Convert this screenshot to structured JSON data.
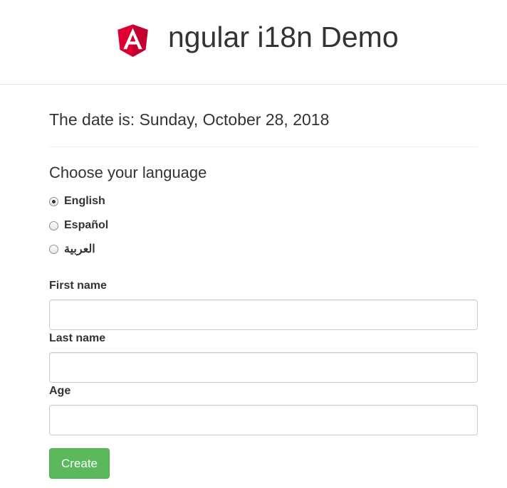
{
  "header": {
    "title": "ngular i18n Demo",
    "logo": {
      "icon": "angular-logo-icon",
      "letter": "A",
      "colors": [
        "#dd0031",
        "#c3002f",
        "#ffffff"
      ]
    }
  },
  "date_line": "The date is: Sunday, October 28, 2018",
  "language": {
    "heading": "Choose your language",
    "options": [
      {
        "label": "English",
        "checked": true
      },
      {
        "label": "Español",
        "checked": false
      },
      {
        "label": "العربية",
        "checked": false
      }
    ]
  },
  "form": {
    "first_name": {
      "label": "First name",
      "value": ""
    },
    "last_name": {
      "label": "Last name",
      "value": ""
    },
    "age": {
      "label": "Age",
      "value": ""
    },
    "submit_label": "Create",
    "submit_color": "#5cb85c"
  }
}
